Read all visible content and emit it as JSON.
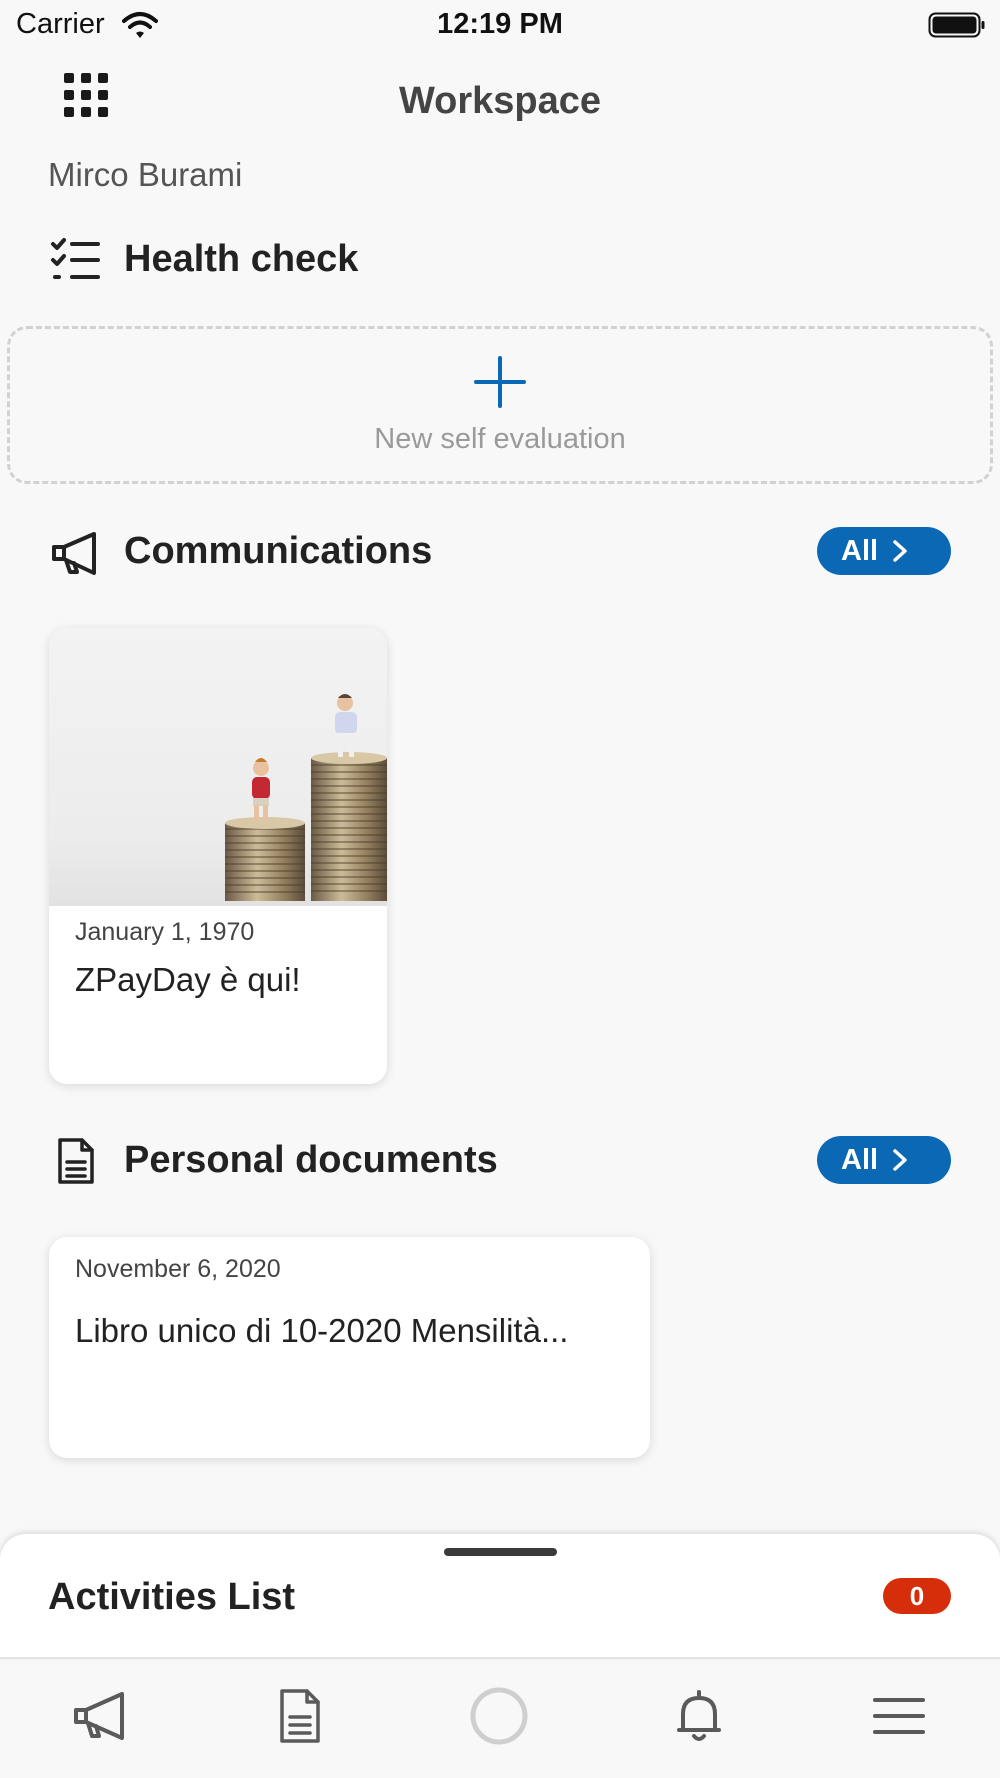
{
  "status_bar": {
    "carrier": "Carrier",
    "time": "12:19 PM",
    "icons": [
      "wifi-icon",
      "battery-icon"
    ]
  },
  "header": {
    "title": "Workspace",
    "menu_icon": "grid-icon",
    "user_name": "Mirco Burami"
  },
  "health_check": {
    "icon": "checklist-icon",
    "title": "Health check",
    "new_eval_icon": "plus-icon",
    "new_eval_label": "New self evaluation"
  },
  "communications": {
    "icon": "megaphone-icon",
    "title": "Communications",
    "all_label": "All",
    "items": [
      {
        "date": "January 1, 1970",
        "title": "ZPayDay è qui!",
        "image": "coins-stacks-figurines"
      }
    ]
  },
  "personal_documents": {
    "icon": "document-icon",
    "title": "Personal documents",
    "all_label": "All",
    "items": [
      {
        "date": "November 6, 2020",
        "title": "Libro unico di 10-2020 Mensilità..."
      }
    ]
  },
  "activities": {
    "title": "Activities List",
    "count": "0"
  },
  "tab_bar": {
    "tabs": [
      "megaphone-icon",
      "document-icon",
      "circle-icon",
      "bell-icon",
      "menu-icon"
    ]
  },
  "colors": {
    "accent": "#0a68b5",
    "badge": "#d62e0b",
    "background": "#f8f8f8"
  }
}
